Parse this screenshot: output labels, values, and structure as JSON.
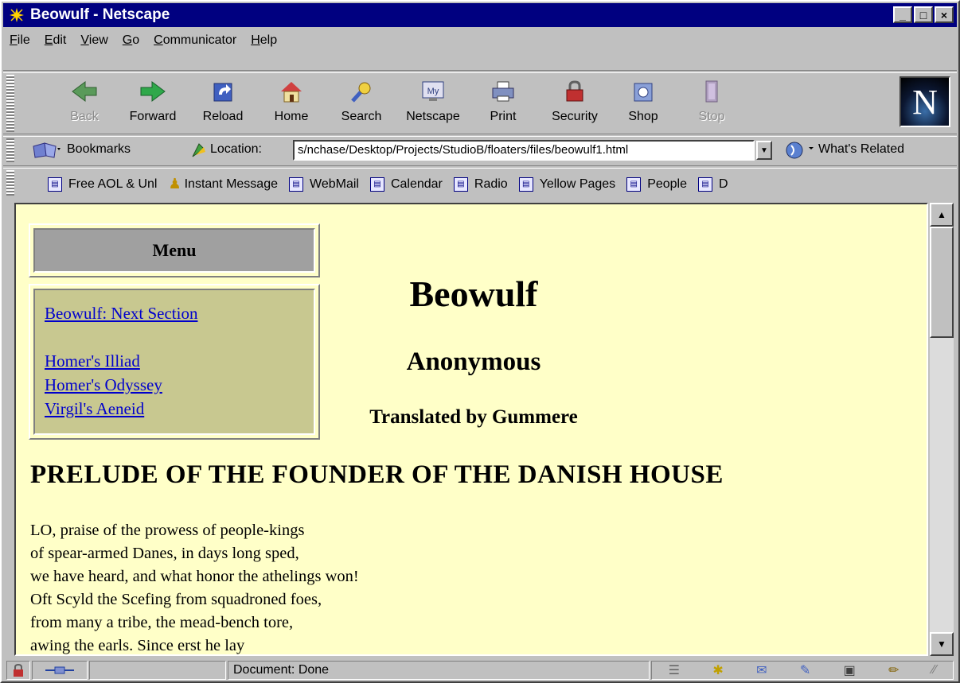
{
  "window": {
    "title": "Beowulf - Netscape",
    "controls": [
      "_",
      "□",
      "×"
    ]
  },
  "menubar": {
    "items": [
      {
        "first": "F",
        "rest": "ile"
      },
      {
        "first": "E",
        "rest": "dit"
      },
      {
        "first": "V",
        "rest": "iew"
      },
      {
        "first": "G",
        "rest": "o"
      },
      {
        "first": "C",
        "rest": "ommunicator"
      },
      {
        "first": "H",
        "rest": "elp"
      }
    ]
  },
  "toolbar": {
    "buttons": [
      {
        "label": "Back",
        "icon": "back-arrow-icon"
      },
      {
        "label": "Forward",
        "icon": "forward-arrow-icon"
      },
      {
        "label": "Reload",
        "icon": "reload-icon"
      },
      {
        "label": "Home",
        "icon": "home-icon"
      },
      {
        "label": "Search",
        "icon": "search-icon"
      },
      {
        "label": "Netscape",
        "icon": "netscape-icon",
        "badge": "My"
      },
      {
        "label": "Print",
        "icon": "print-icon"
      },
      {
        "label": "Security",
        "icon": "security-lock-icon"
      },
      {
        "label": "Shop",
        "icon": "shop-icon"
      },
      {
        "label": "Stop",
        "icon": "stop-icon"
      }
    ],
    "logo_letter": "N"
  },
  "location_bar": {
    "bookmarks_label": "Bookmarks",
    "location_label": "Location:",
    "url": "s/nchase/Desktop/Projects/StudioB/floaters/files/beowulf1.html",
    "whats_related": "What's Related"
  },
  "personal_toolbar": {
    "items": [
      "Free AOL & Unl",
      "Instant Message",
      "WebMail",
      "Calendar",
      "Radio",
      "Yellow Pages",
      "People",
      "D"
    ]
  },
  "page": {
    "menu_heading": "Menu",
    "links": [
      "Beowulf: Next Section",
      "Homer's Illiad",
      "Homer's Odyssey",
      "Virgil's Aeneid"
    ],
    "title": "Beowulf",
    "author": "Anonymous",
    "translator": "Translated by Gummere",
    "section_heading": "PRELUDE OF THE FOUNDER OF THE DANISH HOUSE",
    "poem_lines": [
      "LO, praise of the prowess of people-kings",
      "of spear-armed Danes, in days long sped,",
      "we have heard, and what honor the athelings won!",
      "Oft Scyld the Scefing from squadroned foes,",
      "from many a tribe, the mead-bench tore,",
      "awing the earls. Since erst he lay"
    ]
  },
  "statusbar": {
    "text": "Document: Done"
  },
  "colors": {
    "titlebar": "#000080",
    "page_bg": "#ffffc8",
    "link": "#0000cc",
    "menu_bg": "#a0a0a0",
    "links_bg": "#c8c890"
  }
}
